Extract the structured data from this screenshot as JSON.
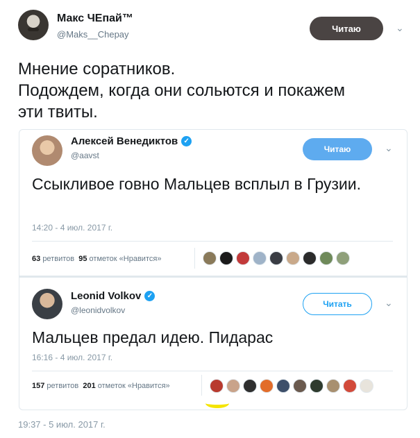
{
  "tweet": {
    "author_name": "Макс ЧЕпай™",
    "author_handle": "@Maks__Chepay",
    "follow_label": "Читаю",
    "text_lines": [
      "Мнение соратников.",
      "Подождем, когда они сольются и покажем",
      "эти твиты."
    ],
    "timestamp": "19:37 - 5 июл. 2017 г."
  },
  "quoted": [
    {
      "author_name": "Алексей Венедиктов",
      "author_handle": "@aavst",
      "follow_label": "Читаю",
      "text": "Ссыкливое говно Мальцев всплыл в Грузии.",
      "timestamp": "14:20 - 4 июл. 2017 г.",
      "retweets_count": "63",
      "retweets_label": "ретвитов",
      "likes_count": "95",
      "likes_label": "отметок «Нравится»"
    },
    {
      "author_name": "Leonid Volkov",
      "author_handle": "@leonidvolkov",
      "follow_label": "Читать",
      "text": "Мальцев предал идею. Пидарас",
      "timestamp": "16:16 - 4 июл. 2017 г.",
      "retweets_count": "157",
      "retweets_label": "ретвитов",
      "likes_count": "201",
      "likes_label": "отметок «Нравится»"
    }
  ],
  "icons": {
    "verified": "verified-check-icon",
    "menu": "chevron-down-icon"
  },
  "colors": {
    "accent": "#1da1f2",
    "follow_dark": "#4a4443",
    "highlight": "#f4e400"
  }
}
